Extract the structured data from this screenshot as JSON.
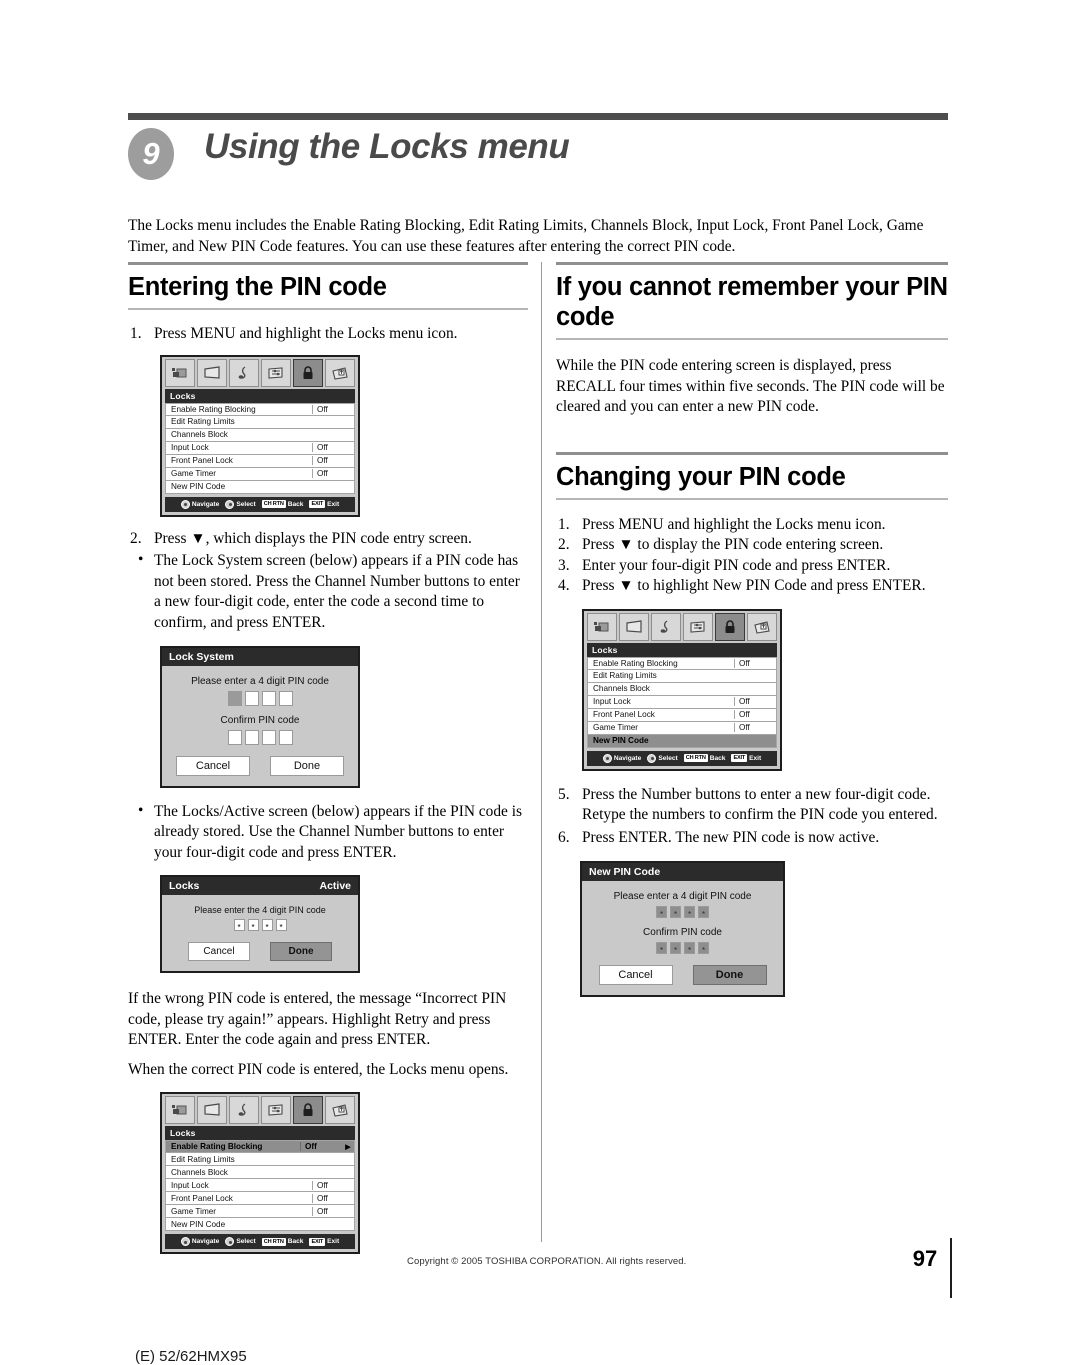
{
  "chapter": {
    "number": "9",
    "title": "Using the Locks menu",
    "intro": "The Locks menu includes the Enable Rating Blocking, Edit Rating Limits, Channels Block, Input Lock, Front Panel Lock, Game Timer, and New PIN Code features. You can use these features after entering the correct PIN code."
  },
  "left_column": {
    "section_title": "Entering the PIN code",
    "step1": {
      "num": "1.",
      "text": "Press MENU and highlight the Locks menu icon."
    },
    "step2": {
      "num": "2.",
      "text": "Press ▼, which displays the PIN code entry screen."
    },
    "bullet1": "The Lock System screen (below) appears if a PIN code has not been stored. Press the Channel Number buttons to enter a new four-digit code, enter the code a second time to confirm, and press ENTER.",
    "bullet2": "The Locks/Active screen (below) appears if the PIN code is already stored. Use the Channel Number buttons to enter your four-digit code and press ENTER.",
    "para_wrong": "If the wrong PIN code is entered, the message “Incorrect PIN code, please try again!” appears. Highlight Retry and press ENTER. Enter the code again and press ENTER.",
    "para_correct": "When the correct PIN code is entered, the Locks menu opens."
  },
  "right_column": {
    "section1_title": "If you cannot remember your PIN code",
    "section1_body": "While the PIN code entering screen is displayed, press RECALL four times within five seconds. The PIN code will be cleared and you can enter a new PIN code.",
    "section2_title": "Changing your PIN code",
    "steps": [
      {
        "num": "1.",
        "text": "Press MENU and highlight the Locks menu icon."
      },
      {
        "num": "2.",
        "text": "Press ▼ to display the PIN code entering screen."
      },
      {
        "num": "3.",
        "text": "Enter your four-digit PIN code and press ENTER."
      },
      {
        "num": "4.",
        "text": "Press ▼ to highlight New PIN Code and press ENTER."
      },
      {
        "num": "5.",
        "text": "Press the Number buttons to enter a new four-digit code. Retype the numbers to confirm the PIN code you entered."
      },
      {
        "num": "6.",
        "text": "Press ENTER. The new PIN code is now active."
      }
    ]
  },
  "osd_menu": {
    "title": "Locks",
    "icons": [
      "picture-icon",
      "screen-icon",
      "audio-icon",
      "settings-icon",
      "locks-icon",
      "setup-icon"
    ],
    "selected_icon_index": 4,
    "rows": [
      {
        "label": "Enable Rating Blocking",
        "value": "Off"
      },
      {
        "label": "Edit Rating Limits",
        "value": ""
      },
      {
        "label": "Channels Block",
        "value": ""
      },
      {
        "label": "Input Lock",
        "value": "Off"
      },
      {
        "label": "Front Panel Lock",
        "value": "Off"
      },
      {
        "label": "Game Timer",
        "value": "Off"
      },
      {
        "label": "New PIN Code",
        "value": ""
      }
    ],
    "footer": {
      "navigate": "Navigate",
      "select": "Select",
      "back_key": "CH RTN",
      "back": "Back",
      "exit_key": "EXIT",
      "exit": "Exit"
    }
  },
  "dialog_lock_system": {
    "title": "Lock System",
    "enter_label": "Please enter a 4 digit PIN code",
    "confirm_label": "Confirm PIN code",
    "cancel": "Cancel",
    "done": "Done"
  },
  "dialog_locks_active": {
    "title": "Locks",
    "status": "Active",
    "enter_label": "Please enter the 4 digit PIN code",
    "digits": [
      "*",
      "*",
      "*",
      "*"
    ],
    "cancel": "Cancel",
    "done": "Done"
  },
  "dialog_new_pin": {
    "title": "New PIN Code",
    "enter_label": "Please enter a 4 digit PIN code",
    "confirm_label": "Confirm PIN code",
    "digits": [
      "*",
      "*",
      "*",
      "*"
    ],
    "cancel": "Cancel",
    "done": "Done"
  },
  "footer": {
    "copyright": "Copyright © 2005 TOSHIBA CORPORATION. All rights reserved.",
    "page_number": "97",
    "model_code": "(E) 52/62HMX95"
  }
}
